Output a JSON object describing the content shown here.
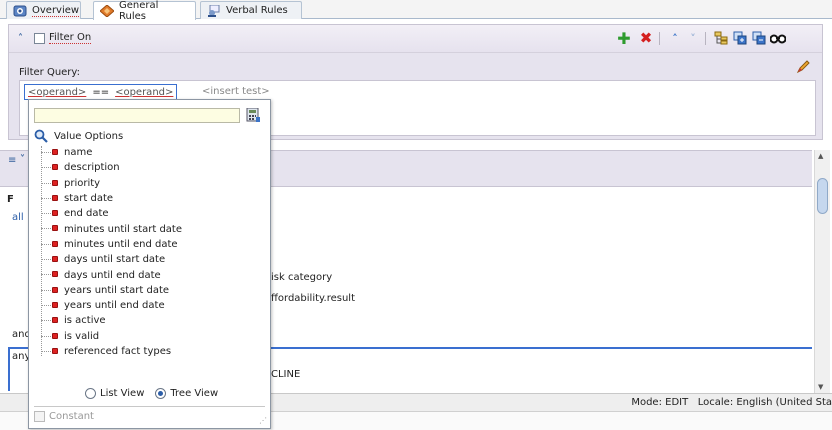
{
  "tabs": [
    {
      "label": "Overview",
      "icon": "overview-icon",
      "active": false
    },
    {
      "label": "General Rules",
      "icon": "rules-diamond-icon",
      "active": true
    },
    {
      "label": "Verbal Rules",
      "icon": "verbal-rules-icon",
      "active": false
    }
  ],
  "filter": {
    "toggle_label": "Filter On",
    "query_label": "Filter Query:",
    "left_operand": "<operand>",
    "operator": "==",
    "right_operand": "<operand>",
    "insert_test": "<insert test>"
  },
  "toolbar": {
    "icons": [
      "add-icon",
      "delete-icon",
      "move-up-icon",
      "move-down-icon",
      "tree-structure-icon",
      "expand-icon",
      "collapse-icon",
      "find-icon",
      "edit-pencil-icon"
    ],
    "colors": {
      "add": "#2e9b2e",
      "delete": "#d42020",
      "nav": "#3c74c8"
    }
  },
  "popup": {
    "search_value": "",
    "title": "Value Options",
    "items": [
      "name",
      "description",
      "priority",
      "start date",
      "end date",
      "minutes until start date",
      "minutes until end date",
      "days until start date",
      "days until end date",
      "years until start date",
      "years until end date",
      "is active",
      "is valid",
      "referenced fact types"
    ],
    "list_view_label": "List View",
    "tree_view_label": "Tree View",
    "selected_view": "Tree View",
    "constant_label": "Constant"
  },
  "background": {
    "f_letter": "F",
    "all_text": "all",
    "risk_category": "isk category",
    "affordability": "ffordability.result",
    "and_text": "and",
    "any_text": "any",
    "decline": "CLINE"
  },
  "status": {
    "mode": "Mode: EDIT",
    "locale": "Locale: English (United Sta"
  }
}
